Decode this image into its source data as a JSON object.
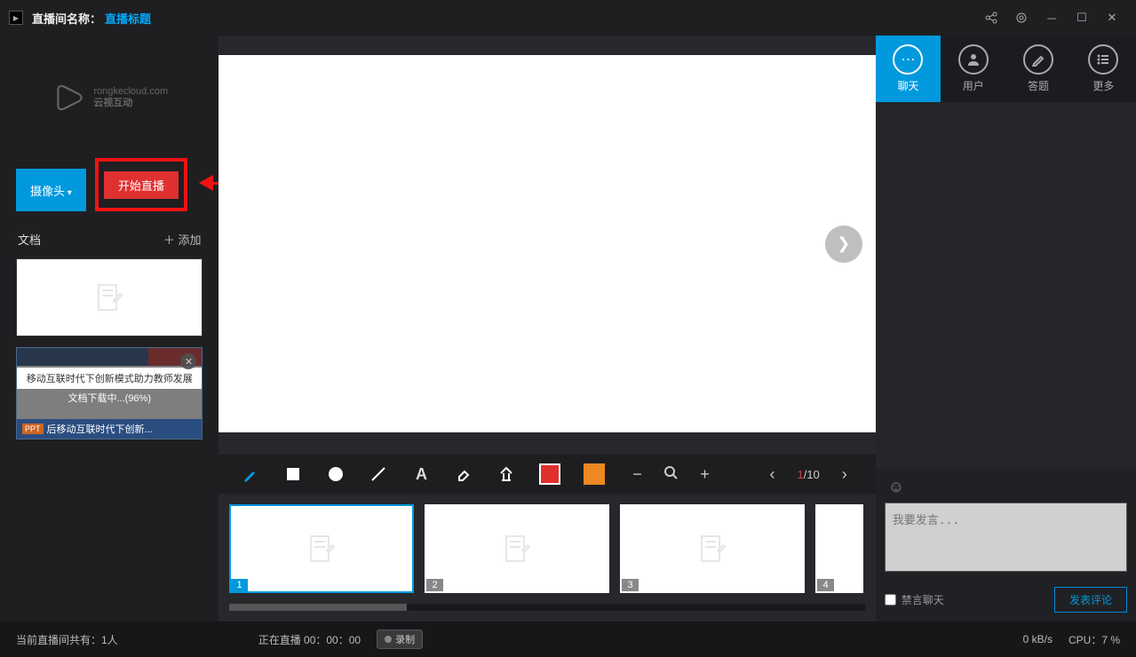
{
  "titlebar": {
    "room_label": "直播间名称：",
    "room_title": "直播标题"
  },
  "sidebar": {
    "camera_btn": "摄像头",
    "start_btn": "开始直播",
    "doc_label": "文档",
    "add_label": "＋ 添加",
    "loading_doc": {
      "white_text": "移动互联时代下创新模式助力教师发展",
      "progress_text": "文档下载中...(96%)",
      "bottom_text": "后移动互联时代下创新...",
      "ppt_badge": "PPT"
    }
  },
  "toolbar": {
    "colors": {
      "red": "#e03030",
      "orange": "#ee8822"
    },
    "page_current": "1",
    "page_total": "/10"
  },
  "slides": [
    "1",
    "2",
    "3",
    "4"
  ],
  "right": {
    "tabs": {
      "chat": "聊天",
      "user": "用户",
      "quiz": "答题",
      "more": "更多"
    },
    "chat_placeholder": "我要发言...",
    "mute_label": "禁言聊天",
    "send_label": "发表评论"
  },
  "status": {
    "viewers": "当前直播间共有：1人",
    "live_text": "正在直播 00：00：00",
    "rec_btn": "录制",
    "net": "0 kB/s",
    "cpu": "CPU：7 %"
  }
}
